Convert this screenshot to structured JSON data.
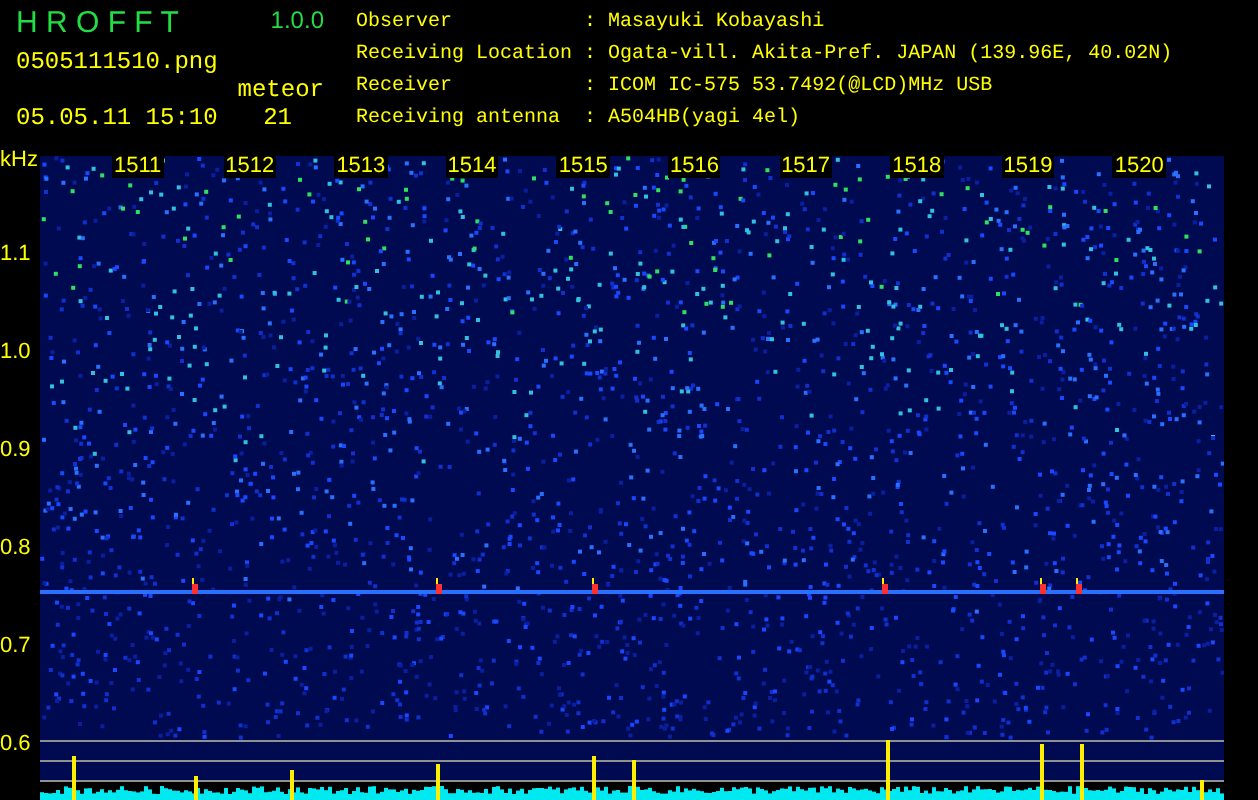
{
  "app": {
    "title": "H R O F F T",
    "version": "1.0.0"
  },
  "file": {
    "name": "0505111510.png",
    "timestamp": "05.05.11 15:10"
  },
  "count": {
    "label": "meteor",
    "value": "21"
  },
  "info": [
    {
      "label": "Observer",
      "separator": ":",
      "value": "Masayuki Kobayashi"
    },
    {
      "label": "Receiving Location",
      "separator": ":",
      "value": "Ogata-vill. Akita-Pref. JAPAN (139.96E, 40.02N)"
    },
    {
      "label": "Receiver",
      "separator": ":",
      "value": "ICOM IC-575 53.7492(@LCD)MHz USB"
    },
    {
      "label": "Receiving antenna",
      "separator": ":",
      "value": "A504HB(yagi 4el)"
    }
  ],
  "y_axis": {
    "unit": "kHz",
    "labels": [
      "1.1",
      "1.0",
      "0.9",
      "0.8",
      "0.7",
      "0.6"
    ]
  },
  "time_labels": [
    "1511",
    "1512",
    "1513",
    "1514",
    "1515",
    "1516",
    "1517",
    "1518",
    "1519",
    "1520"
  ]
}
